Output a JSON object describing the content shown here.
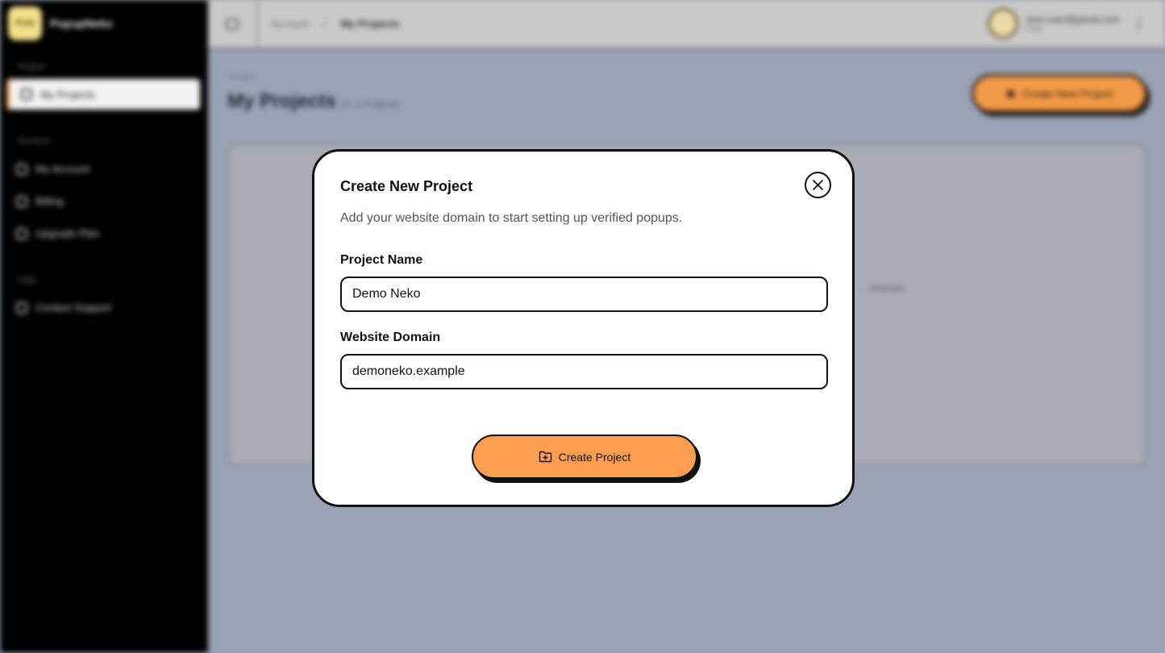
{
  "brand": {
    "logo_text": "PUN",
    "name": "PopupNeko"
  },
  "sidebar": {
    "sections": [
      {
        "label": "Project"
      },
      {
        "label": "Account"
      },
      {
        "label": "Help"
      }
    ],
    "items": [
      {
        "label": "My Projects",
        "icon": "folder-icon",
        "active": true
      },
      {
        "label": "My Account",
        "icon": "user-icon"
      },
      {
        "label": "Billing",
        "icon": "card-icon"
      },
      {
        "label": "Upgrade Plan",
        "icon": "rocket-icon"
      },
      {
        "label": "Contact Support",
        "icon": "send-icon"
      }
    ]
  },
  "topbar": {
    "breadcrumb": [
      "Account",
      "/",
      "My Projects"
    ],
    "user": {
      "avatar_text": "N",
      "email": "new-user@gmail.com",
      "plan": "Free"
    }
  },
  "page": {
    "eyebrow": "Project",
    "title": "My Projects",
    "count": "(0 / 1 Projects)",
    "create_button": "Create New Project",
    "panel_text": "... popups."
  },
  "modal": {
    "title": "Create New Project",
    "description": "Add your website domain to start setting up verified popups.",
    "project_name_label": "Project Name",
    "project_name_value": "Demo Neko",
    "domain_label": "Website Domain",
    "domain_value": "demoneko.example",
    "submit_label": "Create Project"
  },
  "colors": {
    "accent": "#fb9e4f",
    "sidebar_bg": "#000000",
    "backdrop": "#9aa3b5"
  }
}
